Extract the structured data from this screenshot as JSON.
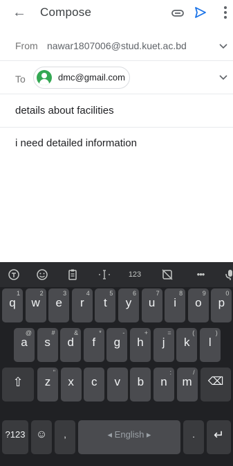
{
  "header": {
    "title": "Compose"
  },
  "from": {
    "label": "From",
    "value": "nawar1807006@stud.kuet.ac.bd"
  },
  "to": {
    "label": "To",
    "recipient": "dmc@gmail.com"
  },
  "subject": "details about facilities",
  "body": "i need detailed information",
  "keyboard": {
    "toolbar": [
      "emoji-kitchen-icon",
      "emoji-icon",
      "clipboard-icon",
      "text-edit-icon",
      "123",
      "no-sticker-icon",
      "•••",
      "mic-icon"
    ],
    "row1": [
      {
        "k": "q",
        "h": "1"
      },
      {
        "k": "w",
        "h": "2"
      },
      {
        "k": "e",
        "h": "3"
      },
      {
        "k": "r",
        "h": "4"
      },
      {
        "k": "t",
        "h": "5"
      },
      {
        "k": "y",
        "h": "6"
      },
      {
        "k": "u",
        "h": "7"
      },
      {
        "k": "i",
        "h": "8"
      },
      {
        "k": "o",
        "h": "9"
      },
      {
        "k": "p",
        "h": "0"
      }
    ],
    "row2": [
      {
        "k": "a",
        "h": "@"
      },
      {
        "k": "s",
        "h": "#"
      },
      {
        "k": "d",
        "h": "&"
      },
      {
        "k": "f",
        "h": "*"
      },
      {
        "k": "g",
        "h": "-"
      },
      {
        "k": "h",
        "h": "+"
      },
      {
        "k": "j",
        "h": "="
      },
      {
        "k": "k",
        "h": "("
      },
      {
        "k": "l",
        "h": ")"
      }
    ],
    "row3": [
      {
        "k": "z",
        "h": "\""
      },
      {
        "k": "x",
        "h": ""
      },
      {
        "k": "c",
        "h": ""
      },
      {
        "k": "v",
        "h": ""
      },
      {
        "k": "b",
        "h": ""
      },
      {
        "k": "n",
        "h": ":"
      },
      {
        "k": "m",
        "h": "/"
      }
    ],
    "symbols_label": "?123",
    "comma": ",",
    "space_label": "◂ English ▸",
    "period": "."
  }
}
